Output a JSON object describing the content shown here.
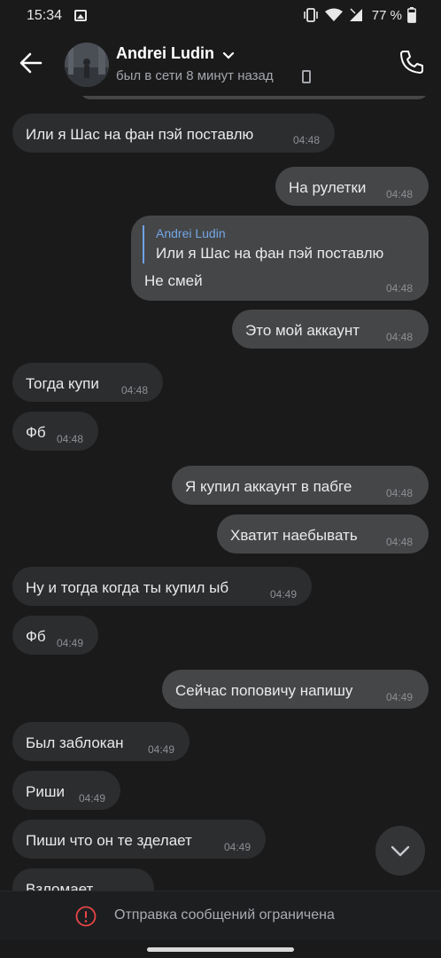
{
  "status_bar": {
    "time": "15:34",
    "battery": "77 %"
  },
  "header": {
    "name": "Andrei Ludin",
    "status": "был в сети 8 минут назад"
  },
  "messages": [
    {
      "dir": "in",
      "text": "Или я Шас на фан пэй поставлю",
      "time": "04:48"
    },
    {
      "dir": "out",
      "text": "На рулетки",
      "time": "04:48"
    },
    {
      "dir": "out",
      "reply_name": "Andrei Ludin",
      "reply_text": "Или я Шас на фан пэй поставлю",
      "text": "Не смей",
      "time": "04:48"
    },
    {
      "dir": "out",
      "text": "Это мой аккаунт",
      "time": "04:48"
    },
    {
      "dir": "in",
      "text": "Тогда купи",
      "time": "04:48"
    },
    {
      "dir": "in",
      "text": "Фб",
      "time": "04:48"
    },
    {
      "dir": "out",
      "text": "Я купил аккаунт в пабге",
      "time": "04:48"
    },
    {
      "dir": "out",
      "text": "Хватит наебывать",
      "time": "04:48"
    },
    {
      "dir": "in",
      "text": "Ну и тогда когда ты купил ыб",
      "time": "04:49"
    },
    {
      "dir": "in",
      "text": "Фб",
      "time": "04:49"
    },
    {
      "dir": "out",
      "text": "Сейчас поповичу напишу",
      "time": "04:49"
    },
    {
      "dir": "in",
      "text": "Был заблокан",
      "time": "04:49"
    },
    {
      "dir": "in",
      "text": "Риши",
      "time": "04:49"
    },
    {
      "dir": "in",
      "text": "Пиши что он те зделает",
      "time": "04:49"
    },
    {
      "dir": "in",
      "text": "Взломает",
      "time": ""
    }
  ],
  "footer": {
    "notice": "Отправка сообщений ограничена"
  },
  "icons": {
    "back": "arrow-left-icon",
    "phone": "phone-icon",
    "chevron": "chevron-down-icon",
    "device": "mobile-device-icon",
    "scroll": "chevron-down-icon",
    "warning": "exclamation-circle-icon"
  },
  "colors": {
    "accent": "#74a7e8",
    "warning": "#e64646",
    "incoming": "#2c2d2f",
    "outgoing": "#454647"
  }
}
